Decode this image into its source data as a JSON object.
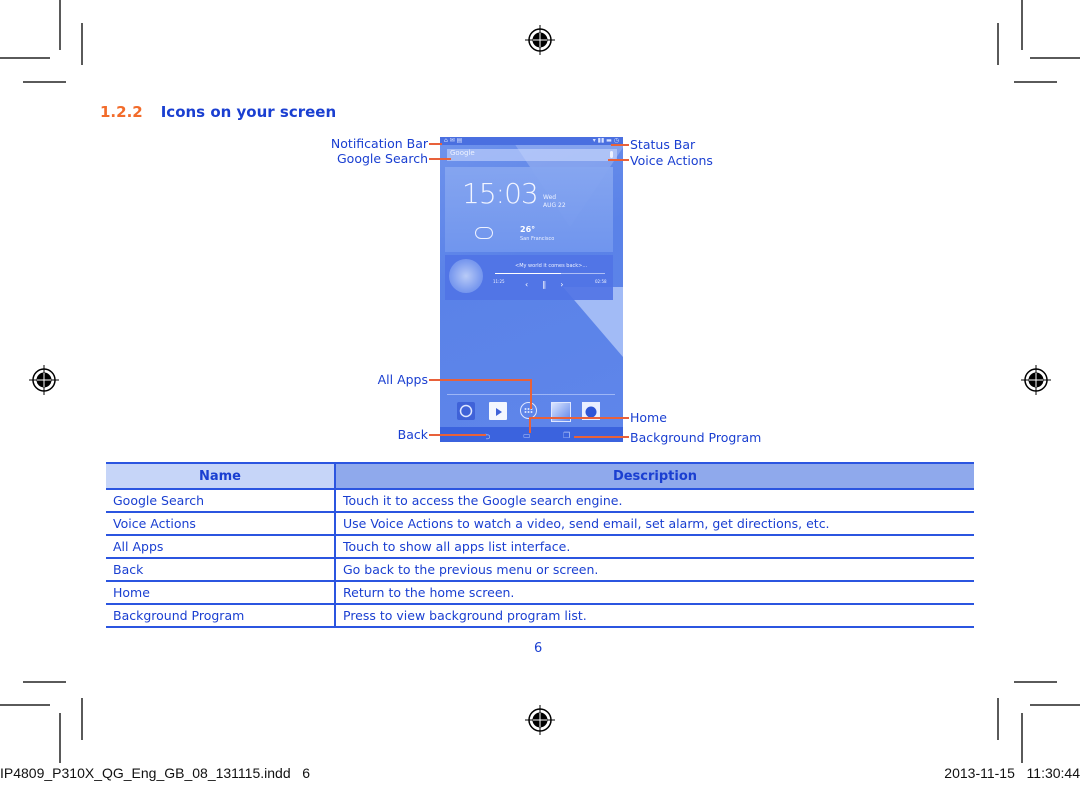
{
  "section": {
    "number": "1.2.2",
    "title": "Icons on your screen"
  },
  "callouts": {
    "notification_bar": "Notification Bar",
    "google_search": "Google Search",
    "status_bar": "Status Bar",
    "voice_actions": "Voice Actions",
    "all_apps": "All Apps",
    "back": "Back",
    "home": "Home",
    "background_program": "Background Program"
  },
  "phone": {
    "search_placeholder": "Google",
    "clock": "15:03",
    "day": "Wed",
    "date": "AUG 22",
    "temperature": "26°",
    "city": "San Francisco",
    "song": "<My world it comes back>...",
    "time_elapsed": "11:25",
    "time_total": "02:58",
    "progress": 0.6,
    "accent_colors": {
      "screen": "#5a82e8",
      "navbar": "#3b63de",
      "callout_line": "#e8613a"
    }
  },
  "table": {
    "headers": [
      "Name",
      "Description"
    ],
    "rows": [
      [
        "Google Search",
        "Touch it to access the Google search engine."
      ],
      [
        "Voice Actions",
        "Use Voice Actions to watch a video, send email, set alarm, get directions, etc."
      ],
      [
        "All Apps",
        "Touch to show all apps list interface."
      ],
      [
        "Back",
        "Go back to the previous menu or screen."
      ],
      [
        "Home",
        "Return to the home screen."
      ],
      [
        "Background Program",
        "Press to view background program list."
      ]
    ]
  },
  "page_number": "6",
  "footer": {
    "file": "IP4809_P310X_QG_Eng_GB_08_131115.indd   6",
    "timestamp": "2013-11-15   11:30:44"
  },
  "colors": {
    "heading_number": "#f26b2a",
    "text_blue": "#1a3fd1",
    "table_rule": "#2b55e0",
    "header_name_bg": "#c6d5f8",
    "header_desc_bg": "#8fa9ec"
  }
}
